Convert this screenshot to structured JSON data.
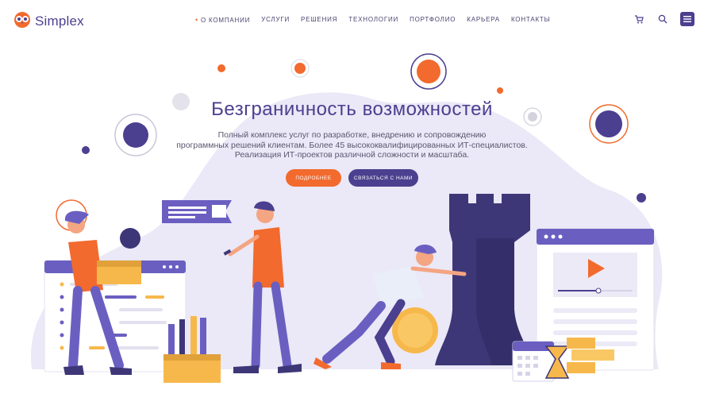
{
  "brand": {
    "name": "Simplex"
  },
  "nav": {
    "items": [
      {
        "label": "О КОМПАНИИ",
        "active": true
      },
      {
        "label": "УСЛУГИ",
        "active": false
      },
      {
        "label": "РЕШЕНИЯ",
        "active": false
      },
      {
        "label": "ТЕХНОЛОГИИ",
        "active": false
      },
      {
        "label": "ПОРТФОЛИО",
        "active": false
      },
      {
        "label": "КАРЬЕРА",
        "active": false
      },
      {
        "label": "КОНТАКТЫ",
        "active": false
      }
    ]
  },
  "header_icons": [
    "cart-icon",
    "search-icon",
    "menu-icon"
  ],
  "hero": {
    "title": "Безграничность возможностей",
    "description_lines": [
      "Полный комплекс услуг по разработке, внедрению и сопровождению",
      "программных решений клиентам. Более 45 высококвалифицированных ИТ-специалистов.",
      "Реализация ИТ-проектов различной сложности и масштаба."
    ],
    "primary_button": "ПОДРОБНЕЕ",
    "secondary_button": "СВЯЗАТЬСЯ С НАМИ"
  },
  "colors": {
    "brand_purple": "#4b3f8f",
    "accent_orange": "#f26a2e",
    "blob_lavender": "#ebe8f7",
    "text_muted": "#5b5770"
  }
}
